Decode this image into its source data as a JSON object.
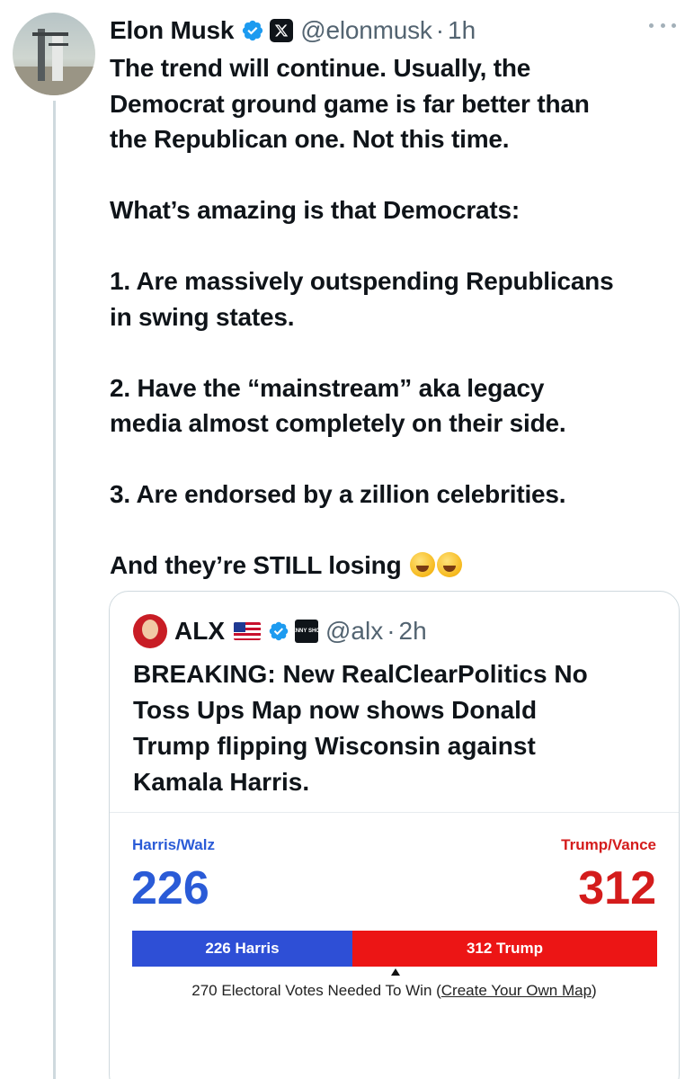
{
  "tweet": {
    "author_name": "Elon Musk",
    "handle": "@elonmusk",
    "separator": "·",
    "time": "1h",
    "paragraphs": [
      [
        "The trend will continue. Usually, the",
        "Democrat ground game is far better than",
        "the Republican one. Not this time."
      ],
      [
        "What’s amazing is that Democrats:"
      ],
      [
        "1. Are massively outspending Republicans",
        "in swing states."
      ],
      [
        "2. Have the “mainstream” aka legacy",
        "media almost completely on their side."
      ],
      [
        "3. Are endorsed by a zillion celebrities."
      ],
      [
        "And they’re STILL losing"
      ]
    ],
    "emoji": "rolling-on-floor-laughing"
  },
  "quote": {
    "author_name": "ALX",
    "handle": "@alx",
    "separator": "·",
    "time": "2h",
    "badge_text": "BENNY SHOW",
    "text_lines": [
      "BREAKING: New RealClearPolitics No",
      "Toss Ups Map now shows Donald",
      "Trump flipping Wisconsin against",
      "Kamala Harris."
    ]
  },
  "electoral_map": {
    "left_label": "Harris/Walz",
    "left_total": "226",
    "right_label": "Trump/Vance",
    "right_total": "312",
    "bar_left_label": "226 Harris",
    "bar_right_label": "312 Trump",
    "left_votes": 226,
    "right_votes": 312,
    "needed_text": "270 Electoral Votes Needed To Win (",
    "link_text": "Create Your Own Map",
    "needed_close": ")",
    "needed_votes": 270,
    "colors": {
      "dem": "#2e4fd6",
      "rep": "#ec1515"
    }
  }
}
